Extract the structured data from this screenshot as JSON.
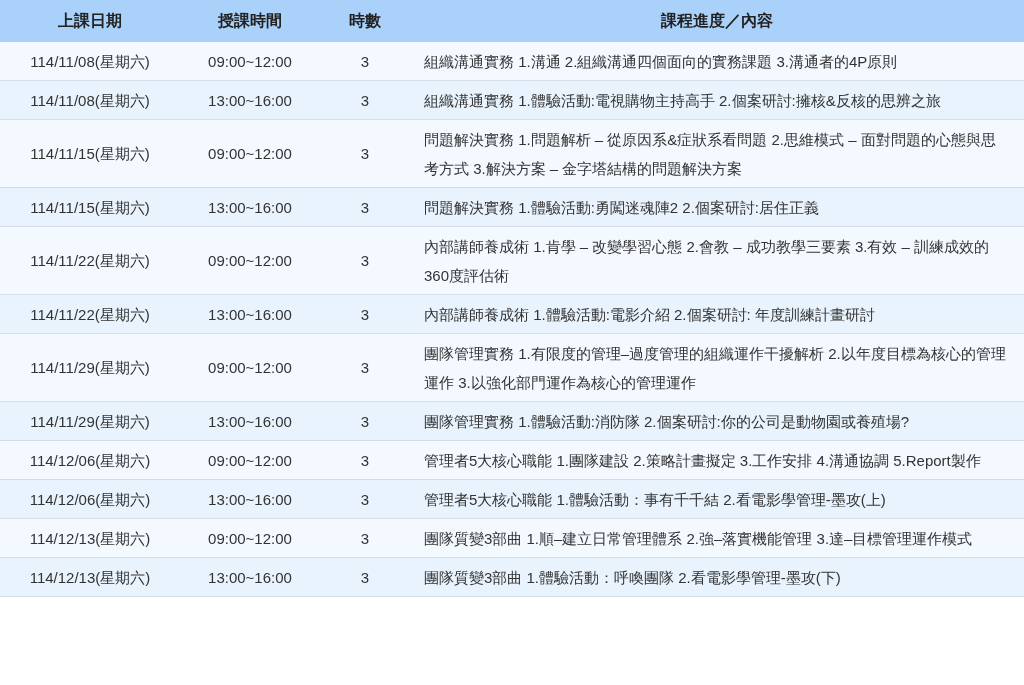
{
  "table": {
    "columns": [
      "上課日期",
      "授課時間",
      "時數",
      "課程進度／內容"
    ],
    "rows": [
      {
        "date": "114/11/08(星期六)",
        "time": "09:00~12:00",
        "hours": "3",
        "content": "組織溝通實務 1.溝通 2.組織溝通四個面向的實務課題 3.溝通者的4P原則"
      },
      {
        "date": "114/11/08(星期六)",
        "time": "13:00~16:00",
        "hours": "3",
        "content": "組織溝通實務 1.體驗活動:電視購物主持高手 2.個案研討:擁核&反核的思辨之旅"
      },
      {
        "date": "114/11/15(星期六)",
        "time": "09:00~12:00",
        "hours": "3",
        "content": "問題解決實務 1.問題解析 – 從原因系&症狀系看問題 2.思維模式 – 面對問題的心態與思考方式 3.解決方案 – 金字塔結構的問題解決方案"
      },
      {
        "date": "114/11/15(星期六)",
        "time": "13:00~16:00",
        "hours": "3",
        "content": "問題解決實務 1.體驗活動:勇闖迷魂陣2 2.個案研討:居住正義"
      },
      {
        "date": "114/11/22(星期六)",
        "time": "09:00~12:00",
        "hours": "3",
        "content": "內部講師養成術 1.肯學 – 改變學習心態 2.會教 – 成功教學三要素 3.有效 – 訓練成效的360度評估術"
      },
      {
        "date": "114/11/22(星期六)",
        "time": "13:00~16:00",
        "hours": "3",
        "content": "內部講師養成術 1.體驗活動:電影介紹 2.個案研討: 年度訓練計畫研討"
      },
      {
        "date": "114/11/29(星期六)",
        "time": "09:00~12:00",
        "hours": "3",
        "content": "團隊管理實務 1.有限度的管理–過度管理的組織運作干擾解析 2.以年度目標為核心的管理運作 3.以強化部門運作為核心的管理運作"
      },
      {
        "date": "114/11/29(星期六)",
        "time": "13:00~16:00",
        "hours": "3",
        "content": "團隊管理實務 1.體驗活動:消防隊 2.個案研討:你的公司是動物園或養殖場?"
      },
      {
        "date": "114/12/06(星期六)",
        "time": "09:00~12:00",
        "hours": "3",
        "content": "管理者5大核心職能 1.團隊建設 2.策略計畫擬定 3.工作安排 4.溝通協調 5.Report製作"
      },
      {
        "date": "114/12/06(星期六)",
        "time": "13:00~16:00",
        "hours": "3",
        "content": "管理者5大核心職能 1.體驗活動：事有千千結 2.看電影學管理-墨攻(上)"
      },
      {
        "date": "114/12/13(星期六)",
        "time": "09:00~12:00",
        "hours": "3",
        "content": "團隊質變3部曲 1.順–建立日常管理體系 2.強–落實機能管理 3.達–目標管理運作模式"
      },
      {
        "date": "114/12/13(星期六)",
        "time": "13:00~16:00",
        "hours": "3",
        "content": "團隊質變3部曲 1.體驗活動：呼喚團隊 2.看電影學管理-墨攻(下)"
      }
    ]
  }
}
